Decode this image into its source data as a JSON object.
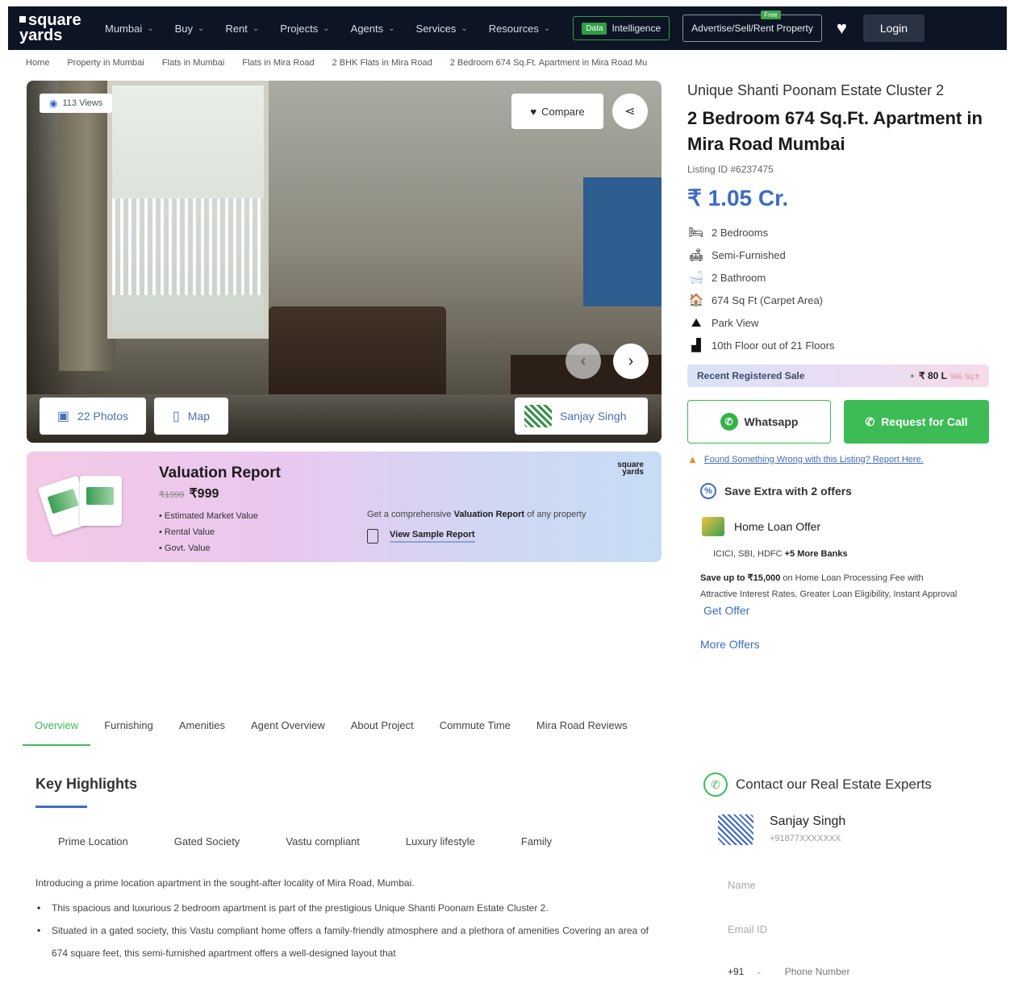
{
  "nav": {
    "logo_top": "square",
    "logo_bottom": "yards",
    "items": [
      {
        "label": "Mumbai"
      },
      {
        "label": "Buy"
      },
      {
        "label": "Rent"
      },
      {
        "label": "Projects"
      },
      {
        "label": "Agents"
      },
      {
        "label": "Services"
      },
      {
        "label": "Resources"
      }
    ],
    "data_tag": "Data",
    "data_label": "Intelligence",
    "advert_label": "Advertise/Sell/Rent Property",
    "free_tag": "Free",
    "login_label": "Login"
  },
  "breadcrumb": [
    "Home",
    "Property in Mumbai",
    "Flats in Mumbai",
    "Flats in Mira Road",
    "2 BHK Flats in Mira Road",
    "2 Bedroom 674 Sq.Ft. Apartment in Mira Road Mu"
  ],
  "gallery": {
    "views": "113 Views",
    "compare_label": "Compare",
    "photos_label": "22 Photos",
    "map_label": "Map",
    "agent_name": "Sanjay Singh"
  },
  "valuation": {
    "title": "Valuation Report",
    "old_price": "₹1999",
    "price": "₹999",
    "items": [
      "Estimated Market Value",
      "Rental Value",
      "Govt. Value"
    ],
    "desc_pre": "Get a comprehensive ",
    "desc_bold": "Valuation Report",
    "desc_post": " of any property",
    "sample_label": "View Sample Report",
    "brand_top": "square",
    "brand_bottom": "yards"
  },
  "property": {
    "project_name": "Unique Shanti Poonam Estate Cluster 2",
    "title": "2 Bedroom 674 Sq.Ft. Apartment in Mira Road Mumbai",
    "listing_id": "Listing ID #6237475",
    "price": "₹ 1.05 Cr.",
    "features": [
      {
        "icon": "bed-icon",
        "glyph": "🛏",
        "label": "2 Bedrooms"
      },
      {
        "icon": "sofa-icon",
        "glyph": "🛋",
        "label": "Semi-Furnished"
      },
      {
        "icon": "bathtub-icon",
        "glyph": "🛁",
        "label": "2 Bathroom"
      },
      {
        "icon": "home-icon",
        "glyph": "🏠",
        "label": "674 Sq Ft  (Carpet Area)"
      },
      {
        "icon": "park-icon",
        "glyph": "⛰",
        "label": "Park View"
      },
      {
        "icon": "stairs-icon",
        "glyph": "▟",
        "label": "10th Floor out of 21 Floors"
      }
    ],
    "recent_sale_label": "Recent Registered Sale",
    "recent_sale_value": "₹ 80 L",
    "recent_sale_unit": "966 Sq.ft",
    "whatsapp_label": "Whatsapp",
    "call_label": "Request for Call",
    "report_text": "Found Something Wrong with this Listing? Report Here.",
    "offers_pre": "Save Extra with ",
    "offers_bold": "2 offers",
    "loan_title": "Home Loan Offer",
    "banks_pre": "ICICI, SBI, HDFC ",
    "banks_bold": "+5 More Banks",
    "loan_save_bold": "Save up to ₹15,000",
    "loan_desc": " on Home Loan Processing Fee with Attractive Interest Rates, Greater Loan Eligibility, Instant Approval",
    "get_offer": "Get Offer",
    "more_offers": "More Offers"
  },
  "tabs": [
    {
      "label": "Overview"
    },
    {
      "label": "Furnishing"
    },
    {
      "label": "Amenities"
    },
    {
      "label": "Agent Overview"
    },
    {
      "label": "About Project"
    },
    {
      "label": "Commute Time"
    },
    {
      "label": "Mira Road Reviews"
    }
  ],
  "highlights": {
    "title": "Key Highlights",
    "chips": [
      "Prime Location",
      "Gated Society",
      "Vastu compliant",
      "Luxury lifestyle",
      "Family"
    ],
    "intro": "Introducing a prime location apartment in the sought-after locality of Mira Road, Mumbai.",
    "bullets": [
      "This spacious and luxurious 2 bedroom apartment is part of the prestigious Unique Shanti Poonam Estate Cluster 2.",
      "Situated in a gated society, this Vastu compliant home offers a family-friendly atmosphere and a plethora of amenities Covering an area of 674 square feet, this semi-furnished apartment offers a well-designed layout that"
    ]
  },
  "experts": {
    "title": "Contact our Real Estate Experts",
    "agent_name": "Sanjay Singh",
    "agent_phone": "+91877XXXXXXX",
    "name_placeholder": "Name",
    "email_placeholder": "Email ID",
    "country_code": "+91",
    "phone_placeholder": "Phone Number"
  }
}
